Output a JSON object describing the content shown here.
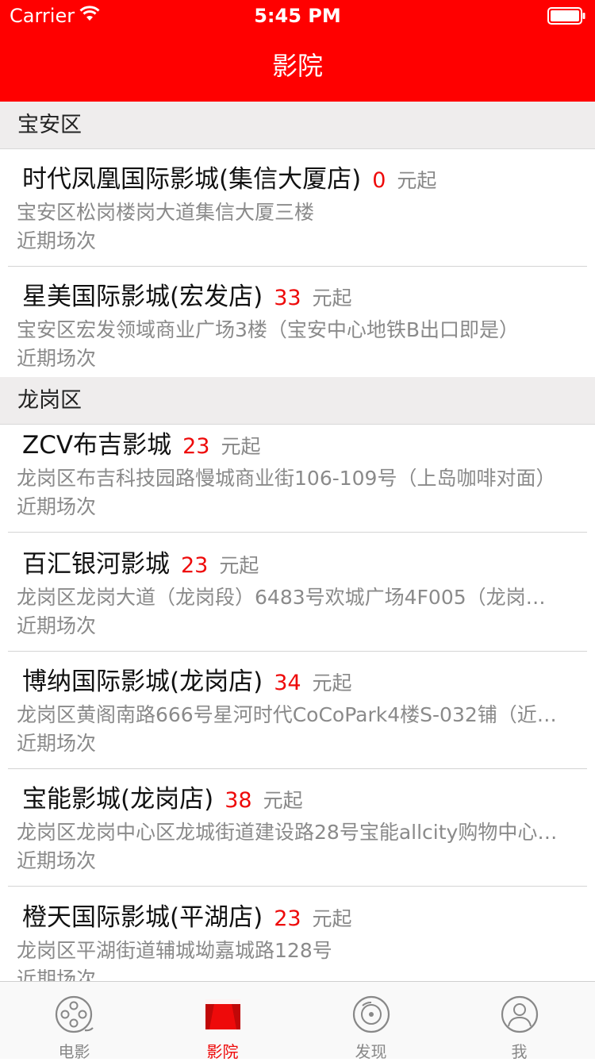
{
  "status_bar": {
    "carrier": "Carrier",
    "time": "5:45 PM"
  },
  "nav": {
    "title": "影院"
  },
  "sections": [
    {
      "title": "宝安区",
      "cinemas": [
        {
          "name": "时代凤凰国际影城(集信大厦店)",
          "price": "0",
          "unit": "元起",
          "address": "宝安区松岗楼岗大道集信大厦三楼",
          "schedule": "近期场次"
        },
        {
          "name": "星美国际影城(宏发店)",
          "price": "33",
          "unit": "元起",
          "address": "宝安区宏发领域商业广场3楼（宝安中心地铁B出口即是）",
          "schedule": "近期场次"
        }
      ]
    },
    {
      "title": "龙岗区",
      "cinemas": [
        {
          "name": "ZCV布吉影城",
          "price": "23",
          "unit": "元起",
          "address": "龙岗区布吉科技园路慢城商业街106-109号（上岛咖啡对面）",
          "schedule": "近期场次"
        },
        {
          "name": "百汇银河影城",
          "price": "23",
          "unit": "元起",
          "address": "龙岗区龙岗大道（龙岗段）6483号欢城广场4F005（龙岗…",
          "schedule": "近期场次"
        },
        {
          "name": "博纳国际影城(龙岗店)",
          "price": "34",
          "unit": "元起",
          "address": "龙岗区黄阁南路666号星河时代CoCoPark4楼S-032铺（近…",
          "schedule": "近期场次"
        },
        {
          "name": "宝能影城(龙岗店)",
          "price": "38",
          "unit": "元起",
          "address": "龙岗区龙岗中心区龙城街道建设路28号宝能allcity购物中心…",
          "schedule": "近期场次"
        },
        {
          "name": "橙天国际影城(平湖店)",
          "price": "23",
          "unit": "元起",
          "address": "龙岗区平湖街道辅城坳嘉城路128号",
          "schedule": "近期场次"
        }
      ]
    }
  ],
  "tab_bar": {
    "active_index": 1,
    "tabs": [
      {
        "label": "电影",
        "icon": "film-reel-icon"
      },
      {
        "label": "影院",
        "icon": "cinema-screen-icon"
      },
      {
        "label": "发现",
        "icon": "discover-compass-icon"
      },
      {
        "label": "我",
        "icon": "user-profile-icon"
      }
    ]
  },
  "colors": {
    "accent": "#ff0000",
    "price": "#ee0a0a",
    "section_bg": "#efeded",
    "muted_text": "#8a8a8a"
  }
}
